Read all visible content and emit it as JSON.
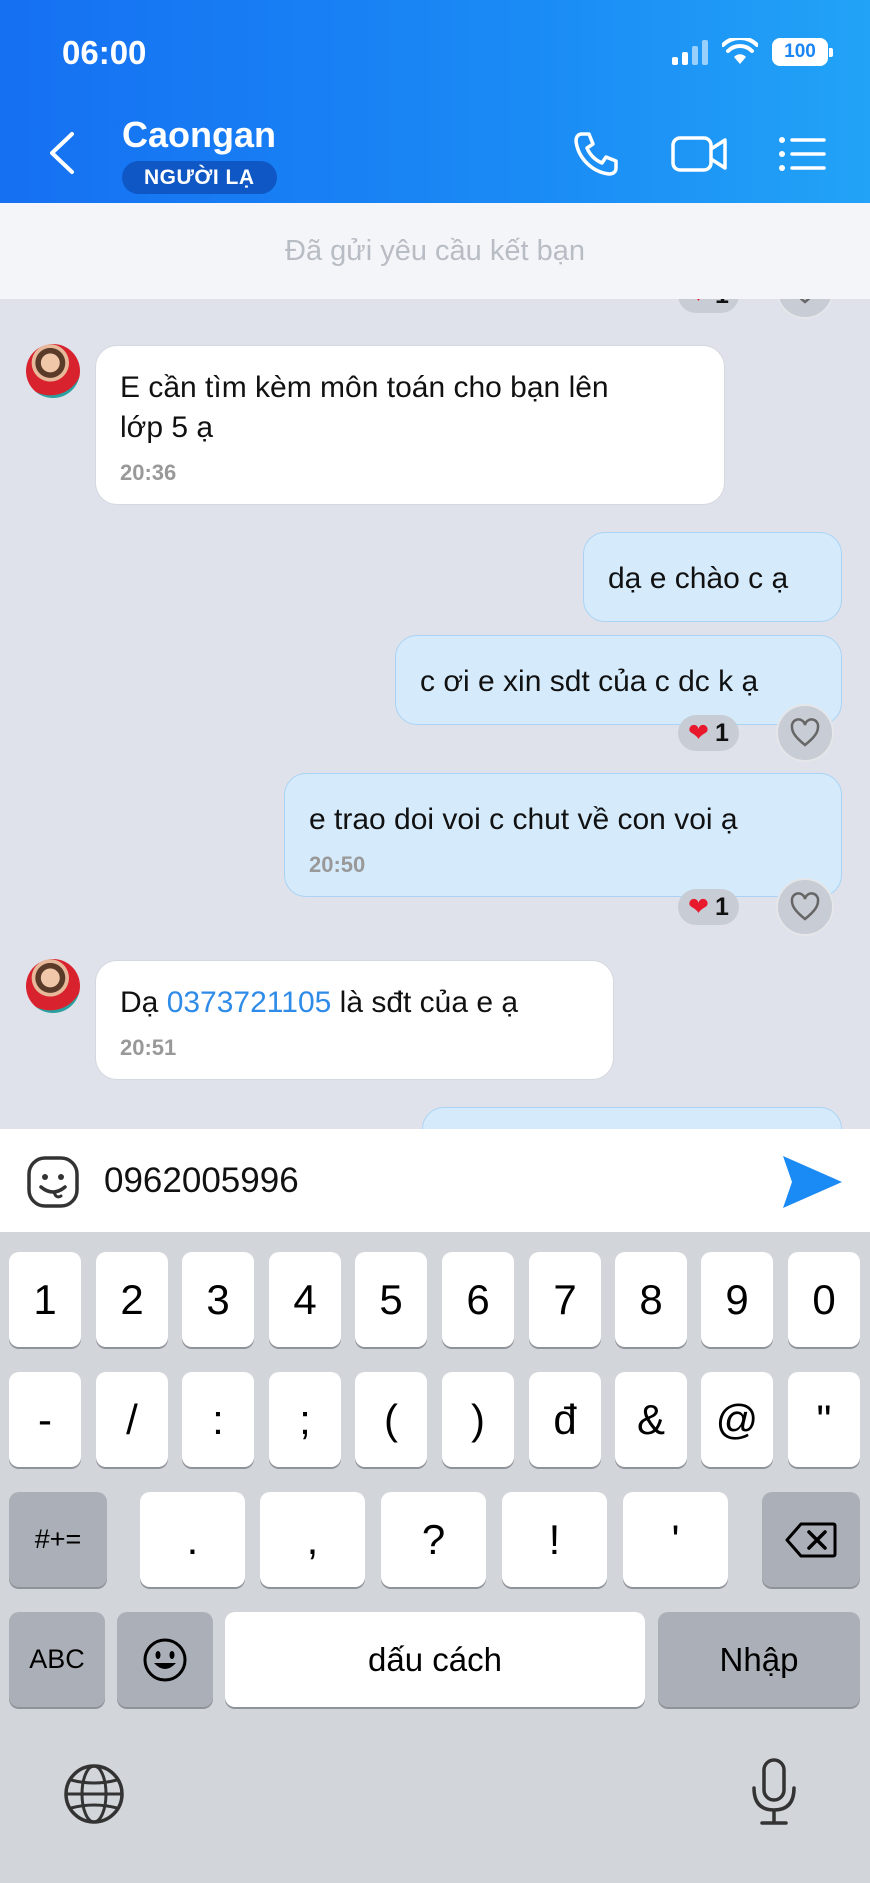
{
  "status_bar": {
    "time": "06:00",
    "battery": "100"
  },
  "header": {
    "title": "Caongan",
    "badge": "NGƯỜI LẠ"
  },
  "banner": {
    "text": "Đã gửi yêu cầu kết bạn"
  },
  "messages": [
    {
      "line1": "E cần tìm kèm môn toán cho bạn lên",
      "line2": "lớp 5 ạ",
      "time": "20:36"
    },
    {
      "text": "dạ e chào c ạ"
    },
    {
      "text": "c ơi e xin sdt của c dc k ạ",
      "reaction_count": "1"
    },
    {
      "text": "e trao doi voi c chut về con voi ạ",
      "time": "20:50",
      "reaction_count": "1"
    },
    {
      "prefix": "Dạ ",
      "phone": "0373721105",
      "suffix": " là sđt của e ạ",
      "time": "20:51"
    }
  ],
  "partial_reaction_count": "1",
  "input": {
    "value": "0962005996"
  },
  "keyboard": {
    "row1": [
      "1",
      "2",
      "3",
      "4",
      "5",
      "6",
      "7",
      "8",
      "9",
      "0"
    ],
    "row2": [
      "-",
      "/",
      ":",
      ";",
      "(",
      ")",
      "đ",
      "&",
      "@",
      "\""
    ],
    "row3_left": "#+=",
    "row3": [
      ".",
      ",",
      "?",
      "!",
      "'"
    ],
    "abc": "ABC",
    "space": "dấu cách",
    "enter": "Nhập"
  }
}
